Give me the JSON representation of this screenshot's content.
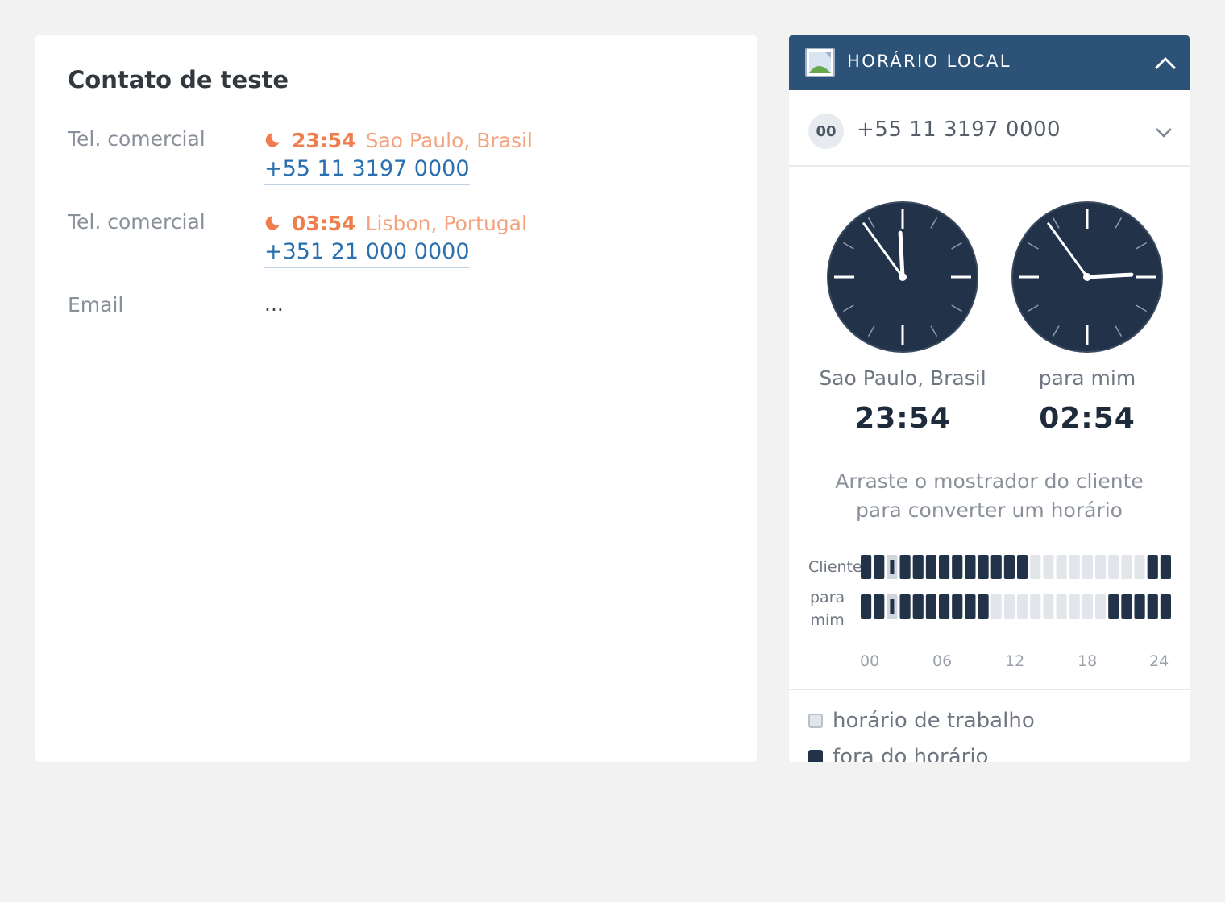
{
  "contact": {
    "name": "Contato de teste",
    "fields": [
      {
        "label": "Tel. comercial",
        "time": "23:54",
        "location": "Sao Paulo, Brasil",
        "phone": "+55 11 3197 0000"
      },
      {
        "label": "Tel. comercial",
        "time": "03:54",
        "location": "Lisbon, Portugal",
        "phone": "+351 21 000 0000"
      }
    ],
    "email": {
      "label": "Email",
      "value": "..."
    }
  },
  "widget": {
    "title": "HORÁRIO LOCAL",
    "selected_country_code": "00",
    "selected_phone": "+55 11 3197 0000",
    "clocks": [
      {
        "label": "Sao Paulo, Brasil",
        "time": "23:54"
      },
      {
        "label": "para mim",
        "time": "02:54"
      }
    ],
    "hint_line1": "Arraste o mostrador do cliente",
    "hint_line2": "para converter um horário",
    "timeline": {
      "client_label": "Cliente",
      "me_label_line1": "para",
      "me_label_line2": "mim",
      "ticks": [
        "00",
        "06",
        "12",
        "18",
        "24"
      ],
      "client_work_hours": [
        13,
        14,
        15,
        16,
        17,
        18,
        19,
        20,
        21
      ],
      "me_work_hours": [
        10,
        11,
        12,
        13,
        14,
        15,
        16,
        17,
        18
      ],
      "current_hour": 2
    },
    "legend": [
      {
        "label": "horário de trabalho",
        "color": "#e2e6ea"
      },
      {
        "label": "fora do horário",
        "color": "#223248"
      }
    ]
  },
  "colors": {
    "header": "#2c5278",
    "accent_orange": "#f07e4c",
    "link_blue": "#2a6fb0",
    "clock_face": "#223248"
  }
}
